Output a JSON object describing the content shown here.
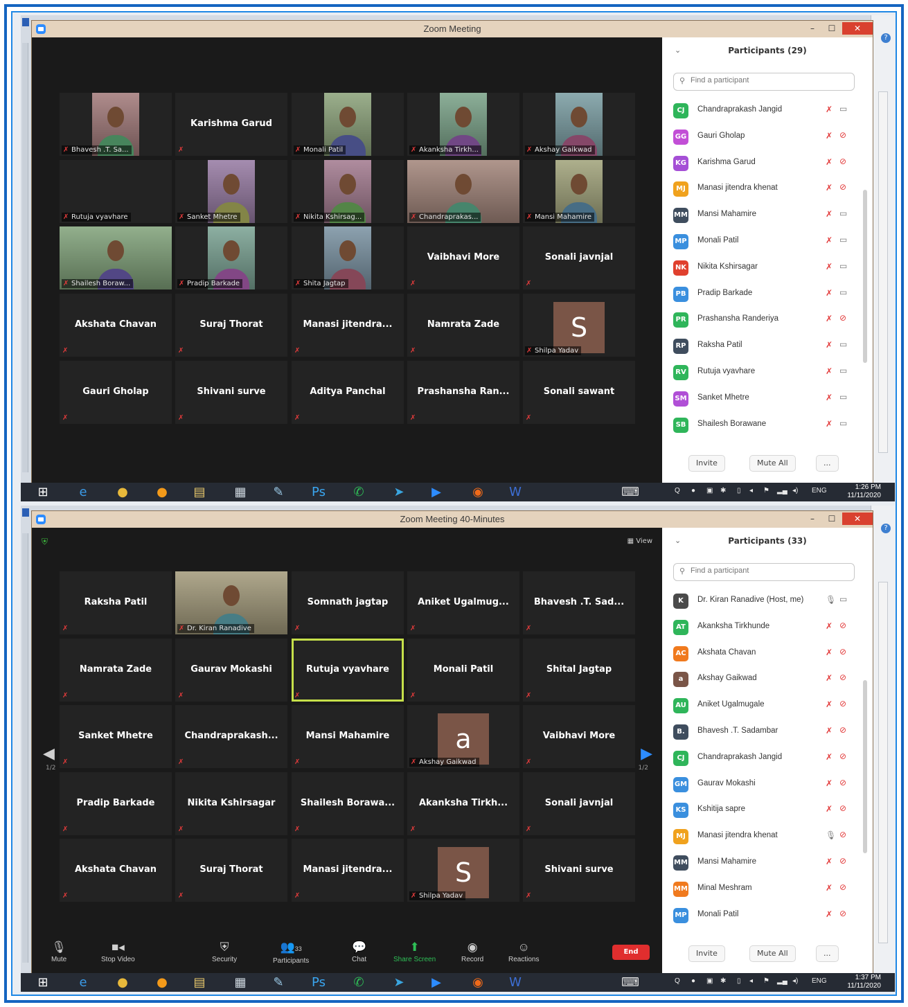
{
  "screens": [
    {
      "title": "Zoom Meeting",
      "participants_header": "Participants (29)",
      "search_placeholder": "Find a participant",
      "invite": "Invite",
      "mute_all": "Mute All",
      "more": "...",
      "tiles": [
        {
          "name": "Bhavesh .T. Sa...",
          "photo": true
        },
        {
          "name": "Karishma Garud",
          "photo": false
        },
        {
          "name": "Monali Patil",
          "photo": true
        },
        {
          "name": "Akanksha Tirkh...",
          "photo": true
        },
        {
          "name": "Akshay Gaikwad",
          "photo": true
        },
        {
          "name": "Rutuja vyavhare",
          "photo": false,
          "label_only": true
        },
        {
          "name": "Sanket Mhetre",
          "photo": true
        },
        {
          "name": "Nikita Kshirsag...",
          "photo": true
        },
        {
          "name": "Chandraprakas...",
          "photo": true,
          "wide": true
        },
        {
          "name": "Mansi Mahamire",
          "photo": true
        },
        {
          "name": "Shailesh Boraw...",
          "photo": true,
          "wide": true
        },
        {
          "name": "Pradip Barkade",
          "photo": true
        },
        {
          "name": "Shita Jagtap",
          "photo": true
        },
        {
          "name": "Vaibhavi More",
          "photo": false
        },
        {
          "name": "Sonali javnjal",
          "photo": false
        },
        {
          "name": "Akshata Chavan",
          "photo": false
        },
        {
          "name": "Suraj Thorat",
          "photo": false
        },
        {
          "name": "Manasi jitendra...",
          "photo": false
        },
        {
          "name": "Namrata Zade",
          "photo": false
        },
        {
          "name": "Shilpa Yadav",
          "avatar": "S"
        },
        {
          "name": "Gauri Gholap",
          "photo": false
        },
        {
          "name": "Shivani surve",
          "photo": false
        },
        {
          "name": "Aditya Panchal",
          "photo": false
        },
        {
          "name": "Prashansha Ran...",
          "photo": false
        },
        {
          "name": "Sonali sawant",
          "photo": false
        }
      ],
      "participants": [
        {
          "initials": "CJ",
          "name": "Chandraprakash Jangid",
          "color": "#2fb55a",
          "mic": "muted",
          "cam": "on"
        },
        {
          "initials": "GG",
          "name": "Gauri Gholap",
          "color": "#c24fd6",
          "mic": "muted",
          "cam": "off"
        },
        {
          "initials": "KG",
          "name": "Karishma Garud",
          "color": "#a54fd6",
          "mic": "muted",
          "cam": "off"
        },
        {
          "initials": "MJ",
          "name": "Manasi jitendra khenat",
          "color": "#f0a21e",
          "mic": "muted",
          "cam": "off"
        },
        {
          "initials": "MM",
          "name": "Mansi Mahamire",
          "color": "#3f4d5e",
          "mic": "muted",
          "cam": "on"
        },
        {
          "initials": "MP",
          "name": "Monali Patil",
          "color": "#3a8fde",
          "mic": "muted",
          "cam": "on"
        },
        {
          "initials": "NK",
          "name": "Nikita Kshirsagar",
          "color": "#e0402e",
          "mic": "muted",
          "cam": "on"
        },
        {
          "initials": "PB",
          "name": "Pradip Barkade",
          "color": "#3a8fde",
          "mic": "muted",
          "cam": "on"
        },
        {
          "initials": "PR",
          "name": "Prashansha Randeriya",
          "color": "#2fb55a",
          "mic": "muted",
          "cam": "off"
        },
        {
          "initials": "RP",
          "name": "Raksha Patil",
          "color": "#3f4d5e",
          "mic": "muted",
          "cam": "on"
        },
        {
          "initials": "RV",
          "name": "Rutuja vyavhare",
          "color": "#2fb55a",
          "mic": "muted",
          "cam": "on"
        },
        {
          "initials": "SM",
          "name": "Sanket Mhetre",
          "color": "#b04fd6",
          "mic": "muted",
          "cam": "on"
        },
        {
          "initials": "SB",
          "name": "Shailesh Borawane",
          "color": "#2fb55a",
          "mic": "muted",
          "cam": "on"
        }
      ],
      "time": "1:26 PM",
      "date": "11/11/2020",
      "lang": "ENG"
    },
    {
      "title": "Zoom Meeting 40-Minutes",
      "participants_header": "Participants (33)",
      "search_placeholder": "Find a participant",
      "invite": "Invite",
      "mute_all": "Mute All",
      "more": "...",
      "view_label": "View",
      "page_indicator": "1/2",
      "tiles": [
        {
          "name": "Raksha Patil",
          "photo": false
        },
        {
          "name": "Dr. Kiran Ranadive",
          "photo": true,
          "wide": true
        },
        {
          "name": "Somnath jagtap",
          "photo": false
        },
        {
          "name": "Aniket Ugalmug...",
          "photo": false
        },
        {
          "name": "Bhavesh .T. Sad...",
          "photo": false
        },
        {
          "name": "Namrata Zade",
          "photo": false
        },
        {
          "name": "Gaurav Mokashi",
          "photo": false
        },
        {
          "name": "Rutuja vyavhare",
          "photo": false,
          "active": true
        },
        {
          "name": "Monali Patil",
          "photo": false
        },
        {
          "name": "Shital Jagtap",
          "photo": false
        },
        {
          "name": "Sanket Mhetre",
          "photo": false
        },
        {
          "name": "Chandraprakash...",
          "photo": false
        },
        {
          "name": "Mansi Mahamire",
          "photo": false
        },
        {
          "name": "Akshay Gaikwad",
          "avatar": "a"
        },
        {
          "name": "Vaibhavi More",
          "photo": false
        },
        {
          "name": "Pradip Barkade",
          "photo": false
        },
        {
          "name": "Nikita Kshirsagar",
          "photo": false
        },
        {
          "name": "Shailesh Borawa...",
          "photo": false
        },
        {
          "name": "Akanksha Tirkh...",
          "photo": false
        },
        {
          "name": "Sonali javnjal",
          "photo": false
        },
        {
          "name": "Akshata Chavan",
          "photo": false
        },
        {
          "name": "Suraj Thorat",
          "photo": false
        },
        {
          "name": "Manasi jitendra...",
          "photo": false
        },
        {
          "name": "Shilpa Yadav",
          "avatar": "S"
        },
        {
          "name": "Shivani surve",
          "photo": false
        }
      ],
      "participants": [
        {
          "initials": "K",
          "name": "Dr. Kiran Ranadive (Host, me)",
          "color": "#4a4a4a",
          "mic": "on",
          "cam": "on"
        },
        {
          "initials": "AT",
          "name": "Akanksha Tirkhunde",
          "color": "#2fb55a",
          "mic": "muted",
          "cam": "off"
        },
        {
          "initials": "AC",
          "name": "Akshata Chavan",
          "color": "#f07a1e",
          "mic": "muted",
          "cam": "off"
        },
        {
          "initials": "a",
          "name": "Akshay Gaikwad",
          "color": "#7a5547",
          "mic": "muted",
          "cam": "off"
        },
        {
          "initials": "AU",
          "name": "Aniket Ugalmugale",
          "color": "#2fb55a",
          "mic": "muted",
          "cam": "off"
        },
        {
          "initials": "B.",
          "name": "Bhavesh .T. Sadambar",
          "color": "#3f4d5e",
          "mic": "muted",
          "cam": "off"
        },
        {
          "initials": "CJ",
          "name": "Chandraprakash Jangid",
          "color": "#2fb55a",
          "mic": "muted",
          "cam": "off"
        },
        {
          "initials": "GM",
          "name": "Gaurav Mokashi",
          "color": "#3a8fde",
          "mic": "muted",
          "cam": "off"
        },
        {
          "initials": "KS",
          "name": "Kshitija sapre",
          "color": "#3a8fde",
          "mic": "muted",
          "cam": "off"
        },
        {
          "initials": "MJ",
          "name": "Manasi jitendra khenat",
          "color": "#f0a21e",
          "mic": "on",
          "cam": "off"
        },
        {
          "initials": "MM",
          "name": "Mansi Mahamire",
          "color": "#3f4d5e",
          "mic": "muted",
          "cam": "off"
        },
        {
          "initials": "MM",
          "name": "Minal Meshram",
          "color": "#f07a1e",
          "mic": "muted",
          "cam": "off"
        },
        {
          "initials": "MP",
          "name": "Monali Patil",
          "color": "#3a8fde",
          "mic": "muted",
          "cam": "off"
        }
      ],
      "toolbar": {
        "mute": "Mute",
        "stop_video": "Stop Video",
        "security": "Security",
        "participants": "Participants",
        "participants_count": "33",
        "chat": "Chat",
        "share": "Share Screen",
        "record": "Record",
        "reactions": "Reactions",
        "end": "End"
      },
      "time": "1:37 PM",
      "date": "11/11/2020",
      "lang": "ENG"
    }
  ]
}
